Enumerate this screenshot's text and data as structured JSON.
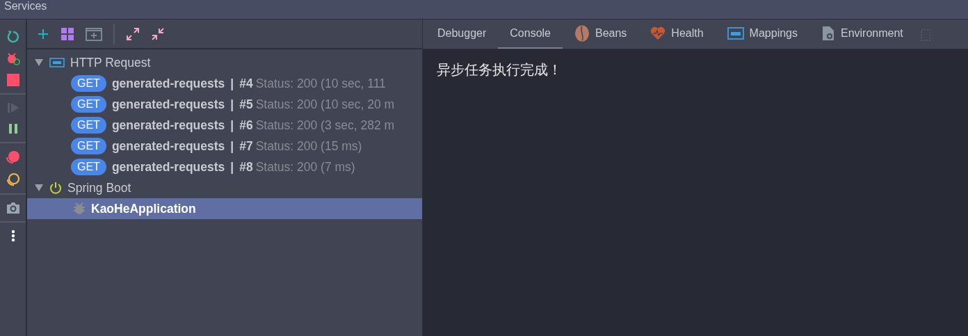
{
  "window": {
    "title": "Services"
  },
  "tree": [
    {
      "label": "HTTP Request",
      "kind": "http",
      "expanded": true,
      "children": [
        {
          "method": "GET",
          "name": "generated-requests",
          "separator": "|",
          "number": "#4",
          "status": "Status: 200 (10 sec, 111",
          "selected": false
        },
        {
          "method": "GET",
          "name": "generated-requests",
          "separator": "|",
          "number": "#5",
          "status": "Status: 200 (10 sec, 20 m",
          "selected": false
        },
        {
          "method": "GET",
          "name": "generated-requests",
          "separator": "|",
          "number": "#6",
          "status": "Status: 200 (3 sec, 282 m",
          "selected": false
        },
        {
          "method": "GET",
          "name": "generated-requests",
          "separator": "|",
          "number": "#7",
          "status": "Status: 200 (15 ms)",
          "selected": false
        },
        {
          "method": "GET",
          "name": "generated-requests",
          "separator": "|",
          "number": "#8",
          "status": "Status: 200 (7 ms)",
          "selected": false
        }
      ]
    },
    {
      "label": "Spring Boot",
      "kind": "spring",
      "expanded": true,
      "children": [
        {
          "name": "KaoHeApplication",
          "selected": true
        }
      ]
    }
  ],
  "tabs": [
    {
      "label": "Debugger",
      "kind": "none",
      "selected": false
    },
    {
      "label": "Console",
      "kind": "none",
      "selected": true
    },
    {
      "label": "Beans",
      "kind": "beans",
      "selected": false
    },
    {
      "label": "Health",
      "kind": "health",
      "selected": false
    },
    {
      "label": "Mappings",
      "kind": "api",
      "selected": false
    },
    {
      "label": "Environment",
      "kind": "env",
      "selected": false
    }
  ],
  "console": [
    "异步任务执行完成！"
  ]
}
